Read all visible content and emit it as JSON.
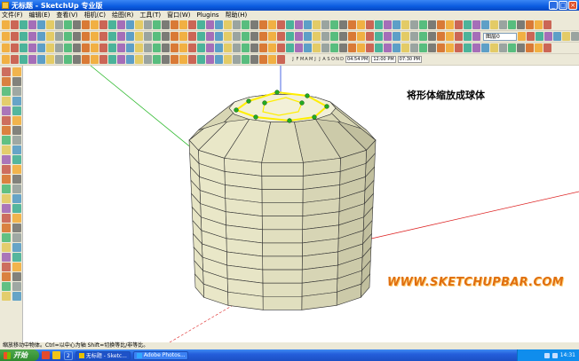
{
  "window": {
    "title": "无标题 - SketchUp 专业版",
    "controls": {
      "minimize": "_",
      "maximize": "□",
      "close": "×"
    }
  },
  "menubar": {
    "items": [
      "文件(F)",
      "编辑(E)",
      "查看(V)",
      "相机(C)",
      "绘图(R)",
      "工具(T)",
      "窗口(W)",
      "Plugins",
      "帮助(H)"
    ]
  },
  "toolbar": {
    "layer_value": "图层0",
    "timeline_months": [
      "J",
      "F",
      "M",
      "A",
      "M",
      "J",
      "J",
      "A",
      "S",
      "O",
      "N",
      "D"
    ],
    "time_start": "04:54 PM",
    "time_mid": "12:00 PM",
    "time_end": "07:30 PM"
  },
  "viewport": {
    "caption": "将形体缩放成球体",
    "watermark": "WWW.SKETCHUPBAR.COM"
  },
  "statusbar": {
    "text": "缩放移动中物体。Ctrl=以中心为轴 Shift=切换等比/非等比。"
  },
  "taskbar": {
    "start_label": "开始",
    "group_label": "2",
    "buttons": [
      {
        "label": "无标题 - Sketc..."
      },
      {
        "label": "Adobe Photos..."
      }
    ],
    "clock": "14:31"
  },
  "colors": {
    "titlebar": "#0a5be0",
    "chrome": "#ece9d8",
    "selection": "#ffee00",
    "grip": "#22aa22",
    "model_light": "#e9e7c8",
    "model_dark": "#bdbb98",
    "axis_red": "#dd2222",
    "axis_green": "#33bb33",
    "axis_blue": "#2244dd"
  }
}
